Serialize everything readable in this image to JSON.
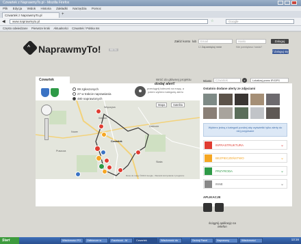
{
  "browser": {
    "title": "Czwartek z NaprawmyTo.pl - Mozilla Firefox",
    "menu": [
      "Plik",
      "Edycja",
      "Widok",
      "Historia",
      "Zakładki",
      "Narzędzia",
      "Pomoc"
    ],
    "tab_label": "Czwartek z NaprawmyTo.pl",
    "url": "www.naprawmyto.pl",
    "search_placeholder": "Google",
    "bookmarks": [
      "Często odwiedzane",
      "Pierwsze kroki",
      "Aktualności",
      "Czwartek / Polska Ins"
    ]
  },
  "site": {
    "logo": "NaprawmyTo!",
    "badge": "BETA",
    "login": {
      "register_label": "Załóż konto",
      "or": "lub",
      "email_placeholder": "Email",
      "password_placeholder": "Hasło",
      "remember": "Zapamiętaj mnie",
      "forgot": "Nie pamiętasz hasła?",
      "submit": "Zaloguj",
      "facebook": "f Zaloguj się"
    },
    "tab_active": "Czwartek",
    "tab_other": "Wróć do głównej projektu",
    "search_label": "Miasto",
    "search_placeholder": "Czwartek",
    "locate_label": "Lokalizuj przez IP/GPS"
  },
  "stats": [
    {
      "value": "99",
      "label": "zgłoszonych",
      "selected": false
    },
    {
      "value": "27",
      "label": "w trakcie naprawiania",
      "selected": false
    },
    {
      "value": "480",
      "label": "naprawionych",
      "selected": true
    },
    {
      "value": "97",
      "label": "które nie będą naprawione",
      "selected": false
    }
  ],
  "callout": {
    "title": "dodaj alert!",
    "text": "przeciągnij kołeczek na mapę, a potem wybierz kategorię alertu"
  },
  "map": {
    "mode_map": "Mapa",
    "mode_sat": "Satelita",
    "places": [
      "Wręczyca",
      "Wielkie",
      "Czwartek",
      "Nowe",
      "Zabłocie",
      "Puszcza",
      "Skała"
    ],
    "footer": "Dane do mapy ©2013 Google - Warunki korzystania z programu"
  },
  "recent": {
    "title": "Ostatnio dodane alerty ze zdjęciami"
  },
  "tip": "Wybierz jedną z kategorii poniżej aby wyświetlić tylko alerty do niej przypisane",
  "categories": [
    {
      "label": "INFRASTRUKTURA",
      "color": "#e03c31",
      "icon": "road-icon"
    },
    {
      "label": "BEZPIECZEŃSTWO",
      "color": "#f5a623",
      "icon": "lock-icon"
    },
    {
      "label": "PRZYRODA",
      "color": "#2e9a47",
      "icon": "tree-icon"
    },
    {
      "label": "INNE",
      "color": "#888888",
      "icon": "question-icon"
    }
  ],
  "apps": {
    "title": "APLIKACJE",
    "caption": "ściągnij aplikację na telefon",
    "apple": "apple-icon",
    "android": "android-icon"
  },
  "taskbar": {
    "start": "Start",
    "tasks": [
      "Wiadomości PO",
      "Odbiorcze w",
      "Facebook - M",
      "Czwartek",
      "Wiadomość do",
      "Szukaj Panel",
      "Naprawmy",
      "Wiadomości"
    ],
    "clock": "13:16"
  },
  "colors": {
    "accent": "#5aa02c",
    "chrome": "#7f97b4"
  }
}
